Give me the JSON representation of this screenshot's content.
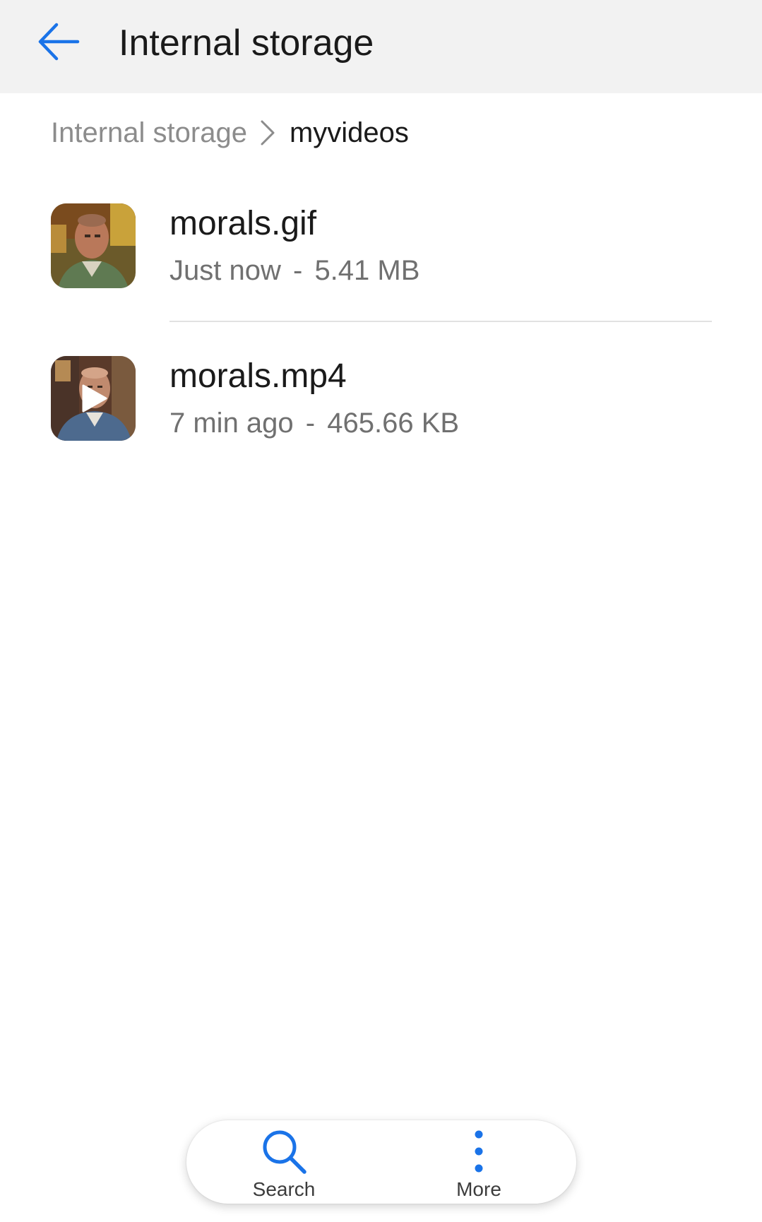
{
  "appbar": {
    "title": "Internal storage",
    "back_icon": "arrow-left-icon",
    "accent_color": "#1a73e8"
  },
  "breadcrumb": {
    "root": "Internal storage",
    "separator_icon": "chevron-right-icon",
    "current": "myvideos"
  },
  "files": [
    {
      "name": "morals.gif",
      "time": "Just now",
      "size": "5.41 MB",
      "thumbnail": "gif-thumbnail"
    },
    {
      "name": "morals.mp4",
      "time": "7 min ago",
      "size": "465.66 KB",
      "thumbnail": "video-thumbnail-with-play-icon"
    }
  ],
  "meta_separator": "-",
  "toolbar": {
    "search_label": "Search",
    "search_icon": "search-icon",
    "more_label": "More",
    "more_icon": "more-vertical-icon"
  }
}
